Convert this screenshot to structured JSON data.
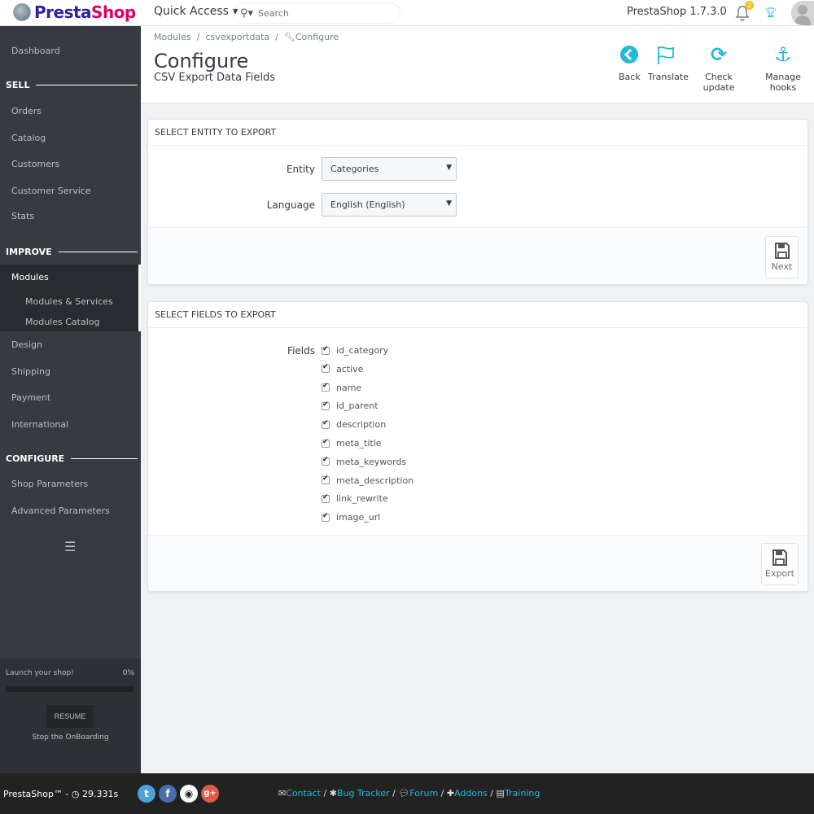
{
  "topbar": {
    "logo": {
      "part1": "Presta",
      "part2": "Shop"
    },
    "quick_access": "Quick Access ▾",
    "search": {
      "placeholder": "Search",
      "icon": "search-icon"
    },
    "version": "PrestaShop 1.7.3.0",
    "notifications_count": "2"
  },
  "sidebar": {
    "dashboard": "Dashboard",
    "sections": {
      "sell": "SELL",
      "improve": "IMPROVE",
      "configure": "CONFIGURE"
    },
    "sell_items": [
      "Orders",
      "Catalog",
      "Customers",
      "Customer Service",
      "Stats"
    ],
    "improve_items": [
      "Modules",
      "Design",
      "Shipping",
      "Payment",
      "International"
    ],
    "modules_sub": [
      "Modules & Services",
      "Modules Catalog"
    ],
    "configure_items": [
      "Shop Parameters",
      "Advanced Parameters"
    ],
    "onboarding": {
      "label": "Launch your shop!",
      "percent_text": "0%",
      "progress": 0,
      "resume": "RESUME",
      "stop": "Stop the OnBoarding"
    }
  },
  "header": {
    "breadcrumb": [
      "Modules",
      "csvexportdata",
      "Configure"
    ],
    "title": "Configure",
    "subtitle": "CSV Export Data Fields",
    "toolbar": [
      {
        "label": "Back",
        "icon": "back-circle-icon"
      },
      {
        "label": "Translate",
        "icon": "flag-icon"
      },
      {
        "label": "Check update",
        "icon": "refresh-icon"
      },
      {
        "label": "Manage hooks",
        "icon": "anchor-icon"
      }
    ]
  },
  "entity_panel": {
    "heading": "SELECT ENTITY TO EXPORT",
    "entity_label": "Entity",
    "entity_value": "Categories",
    "language_label": "Language",
    "language_value": "English (English)",
    "next": "Next"
  },
  "fields_panel": {
    "heading": "SELECT FIELDS TO EXPORT",
    "fields_label": "Fields",
    "fields": [
      {
        "name": "id_category",
        "checked": true
      },
      {
        "name": "active",
        "checked": true
      },
      {
        "name": "name",
        "checked": true
      },
      {
        "name": "id_parent",
        "checked": true
      },
      {
        "name": "description",
        "checked": true
      },
      {
        "name": "meta_title",
        "checked": true
      },
      {
        "name": "meta_keywords",
        "checked": true
      },
      {
        "name": "meta_description",
        "checked": true
      },
      {
        "name": "link_rewrite",
        "checked": true
      },
      {
        "name": "image_url",
        "checked": true
      }
    ],
    "export": "Export"
  },
  "footer": {
    "brand": "PrestaShop™ - ",
    "time": "29.331s",
    "links": [
      "Contact",
      "Bug Tracker",
      "Forum",
      "Addons",
      "Training"
    ]
  },
  "colors": {
    "accent": "#25b9d7",
    "sidebar": "#363a41",
    "badge": "#fbbb22"
  }
}
